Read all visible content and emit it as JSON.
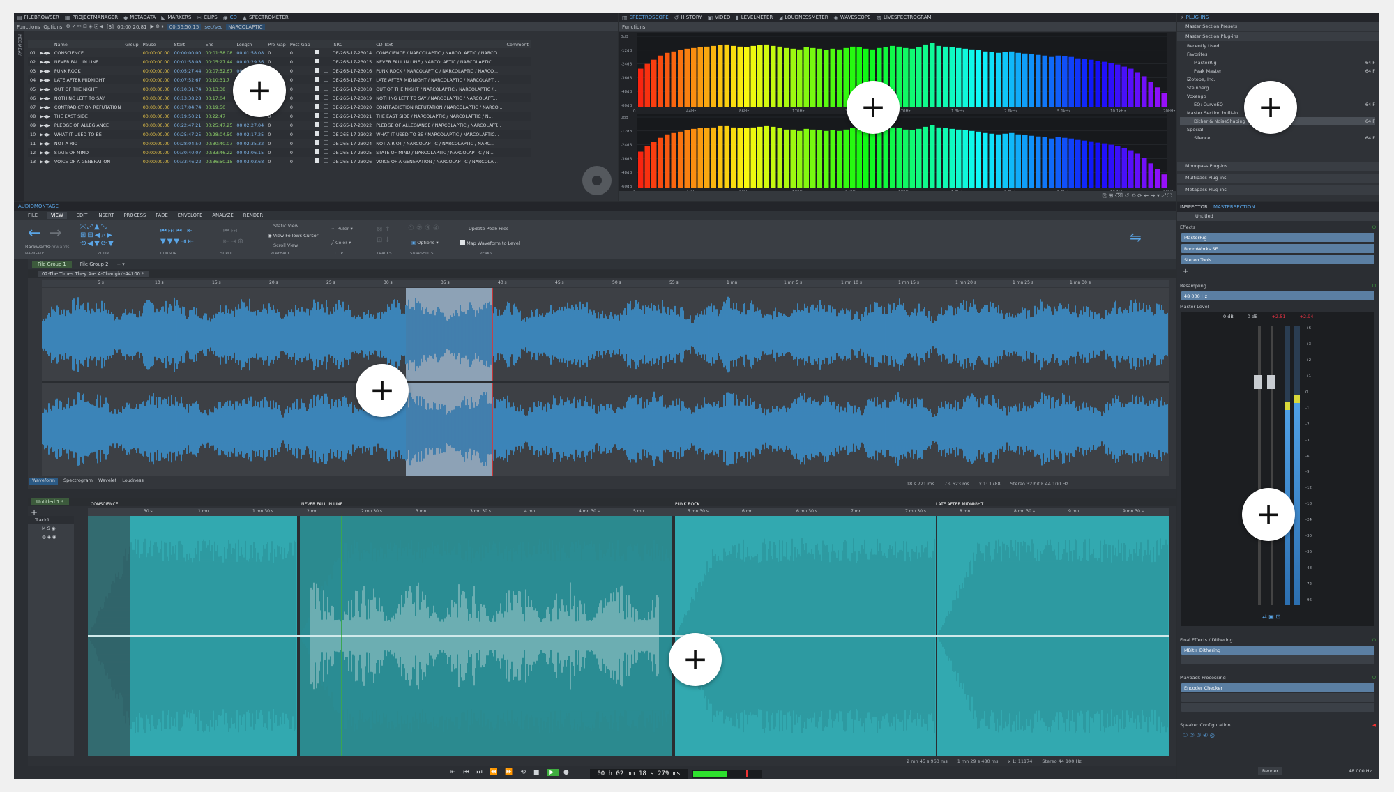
{
  "top_tabs_left": [
    {
      "icon": "file-browser-icon",
      "glyph": "▤",
      "label": "FILEBROWSER"
    },
    {
      "icon": "project-manager-icon",
      "glyph": "▦",
      "label": "PROJECTMANAGER"
    },
    {
      "icon": "metadata-icon",
      "glyph": "◆",
      "label": "METADATA"
    },
    {
      "icon": "markers-icon",
      "glyph": "◣",
      "label": "MARKERS"
    },
    {
      "icon": "clips-icon",
      "glyph": "✂",
      "label": "CLIPS"
    },
    {
      "icon": "cd-icon",
      "glyph": "◉",
      "label": "CD"
    },
    {
      "icon": "spectrometer-icon",
      "glyph": "▲",
      "label": "SPECTROMETER"
    }
  ],
  "top_tabs_mid": [
    {
      "icon": "spectroscope-icon",
      "glyph": "▥",
      "label": "SPECTROSCOPE"
    },
    {
      "icon": "history-icon",
      "glyph": "↺",
      "label": "HISTORY"
    },
    {
      "icon": "video-icon",
      "glyph": "▣",
      "label": "VIDEO"
    },
    {
      "icon": "levelmeter-icon",
      "glyph": "▮",
      "label": "LEVELMETER"
    },
    {
      "icon": "loudnessmeter-icon",
      "glyph": "◢",
      "label": "LOUDNESSMETER"
    },
    {
      "icon": "wavescope-icon",
      "glyph": "◈",
      "label": "WAVESCOPE"
    },
    {
      "icon": "livespectrogram-icon",
      "glyph": "▨",
      "label": "LIVESPECTROGRAM"
    }
  ],
  "plugins_tab": "PLUG-INS",
  "cd_toolbar": {
    "functions": "Functions",
    "options": "Options",
    "counter": "[3]",
    "time1": "00:00:20.81",
    "time2": "00:36:50.15",
    "mode": "sec/sec",
    "album": "NARCOLAPTIC"
  },
  "side_label": "MEDIABAY",
  "cd_columns": [
    "Name",
    "Group",
    "Pause",
    "Start",
    "End",
    "Length",
    "Pre-Gap",
    "Post-Gap",
    "ISRC",
    "CD-Text",
    "Comment"
  ],
  "cd_tracks": [
    {
      "n": "01",
      "name": "CONSCIENCE",
      "pause": "00:00:00.00",
      "start": "00:00:00.00",
      "end": "00:01:58.08",
      "len": "00:01:58.08",
      "pre": "0",
      "post": "0",
      "isrc": "DE-265-17-23014",
      "text": "CONSCIENCE / NARCOLAPTIC / NARCOLAPTIC / NARCO..."
    },
    {
      "n": "02",
      "name": "NEVER FALL IN LINE",
      "pause": "00:00:00.00",
      "start": "00:01:58.08",
      "end": "00:05:27.44",
      "len": "00:03:29.36",
      "pre": "0",
      "post": "0",
      "isrc": "DE-265-17-23015",
      "text": "NEVER FALL IN LINE / NARCOLAPTIC / NARCOLAPTIC..."
    },
    {
      "n": "03",
      "name": "PUNK ROCK",
      "pause": "00:00:00.00",
      "start": "00:05:27.44",
      "end": "00:07:52.67",
      "len": "00:02:25.23",
      "pre": "0",
      "post": "0",
      "isrc": "DE-265-17-23016",
      "text": "PUNK ROCK / NARCOLAPTIC / NARCOLAPTIC / NARCO..."
    },
    {
      "n": "04",
      "name": "LATE AFTER MIDNIGHT",
      "pause": "00:00:00.00",
      "start": "00:07:52.67",
      "end": "00:10:31.7",
      "len": "",
      "pre": "0",
      "post": "0",
      "isrc": "DE-265-17-23017",
      "text": "LATE AFTER MIDNIGHT / NARCOLAPTIC / NARCOLAPTI..."
    },
    {
      "n": "05",
      "name": "OUT OF THE NIGHT",
      "pause": "00:00:00.00",
      "start": "00:10:31.74",
      "end": "00:13:38",
      "len": "",
      "pre": "0",
      "post": "0",
      "isrc": "DE-265-17-23018",
      "text": "OUT OF THE NIGHT / NARCOLAPTIC / NARCOLAPTIC /..."
    },
    {
      "n": "06",
      "name": "NOTHING LEFT TO SAY",
      "pause": "00:00:00.00",
      "start": "00:13:38.28",
      "end": "00:17:04",
      "len": "",
      "pre": "0",
      "post": "0",
      "isrc": "DE-265-17-23019",
      "text": "NOTHING LEFT TO SAY / NARCOLAPTIC / NARCOLAPT..."
    },
    {
      "n": "07",
      "name": "CONTRADICTION REFUTATION",
      "pause": "00:00:00.00",
      "start": "00:17:04.74",
      "end": "00:19:50",
      "len": "",
      "pre": "0",
      "post": "0",
      "isrc": "DE-265-17-23020",
      "text": "CONTRADICTION REFUTATION / NARCOLAPTIC / NARCO..."
    },
    {
      "n": "08",
      "name": "THE EAST SIDE",
      "pause": "00:00:00.00",
      "start": "00:19:50.21",
      "end": "00:22:47",
      "len": "",
      "pre": "0",
      "post": "0",
      "isrc": "DE-265-17-23021",
      "text": "THE EAST SIDE / NARCOLAPTIC / NARCOLAPTIC / N..."
    },
    {
      "n": "09",
      "name": "PLEDGE OF ALLEGIANCE",
      "pause": "00:00:00.00",
      "start": "00:22:47.21",
      "end": "00:25:47.25",
      "len": "00:02:27.04",
      "pre": "0",
      "post": "0",
      "isrc": "DE-265-17-23022",
      "text": "PLEDGE OF ALLEGIANCE / NARCOLAPTIC / NARCOLAPT..."
    },
    {
      "n": "10",
      "name": "WHAT IT USED TO BE",
      "pause": "00:00:00.00",
      "start": "00:25:47.25",
      "end": "00:28:04.50",
      "len": "00:02:17.25",
      "pre": "0",
      "post": "0",
      "isrc": "DE-265-17-23023",
      "text": "WHAT IT USED TO BE / NARCOLAPTIC / NARCOLAPTIC..."
    },
    {
      "n": "11",
      "name": "NOT A RIOT",
      "pause": "00:00:00.00",
      "start": "00:28:04.50",
      "end": "00:30:40.07",
      "len": "00:02:35.32",
      "pre": "0",
      "post": "0",
      "isrc": "DE-265-17-23024",
      "text": "NOT A RIOT / NARCOLAPTIC / NARCOLAPTIC / NARC..."
    },
    {
      "n": "12",
      "name": "STATE OF MIND",
      "pause": "00:00:00.00",
      "start": "00:30:40.07",
      "end": "00:33:46.22",
      "len": "00:03:06.15",
      "pre": "0",
      "post": "0",
      "isrc": "DE-265-17-23025",
      "text": "STATE OF MIND / NARCOLAPTIC / NARCOLAPTIC / N..."
    },
    {
      "n": "13",
      "name": "VOICE OF A GENERATION",
      "pause": "00:00:00.00",
      "start": "00:33:46.22",
      "end": "00:36:50.15",
      "len": "00:03:03.68",
      "pre": "0",
      "post": "0",
      "isrc": "DE-265-17-23026",
      "text": "VOICE OF A GENERATION / NARCOLAPTIC / NARCOLA..."
    }
  ],
  "spectro": {
    "functions": "Functions",
    "db_labels": [
      "0dB",
      "-12dB",
      "-24dB",
      "-36dB",
      "-48dB",
      "-60dB"
    ],
    "freq_labels": [
      "0",
      "44Hz",
      "86Hz",
      "170Hz",
      "340Hz",
      "670Hz",
      "1.3kHz",
      "2.6kHz",
      "5.1kHz",
      "10.1kHz",
      "20kHz"
    ],
    "bars_top": [
      0.55,
      0.62,
      0.68,
      0.74,
      0.78,
      0.8,
      0.82,
      0.84,
      0.85,
      0.86,
      0.87,
      0.88,
      0.89,
      0.9,
      0.88,
      0.87,
      0.86,
      0.88,
      0.89,
      0.9,
      0.88,
      0.87,
      0.85,
      0.84,
      0.83,
      0.86,
      0.85,
      0.84,
      0.82,
      0.84,
      0.83,
      0.85,
      0.87,
      0.86,
      0.84,
      0.83,
      0.85,
      0.86,
      0.88,
      0.87,
      0.85,
      0.84,
      0.86,
      0.9,
      0.92,
      0.88,
      0.87,
      0.86,
      0.85,
      0.84,
      0.83,
      0.82,
      0.8,
      0.79,
      0.78,
      0.79,
      0.8,
      0.78,
      0.77,
      0.76,
      0.75,
      0.74,
      0.72,
      0.74,
      0.73,
      0.72,
      0.7,
      0.69,
      0.68,
      0.66,
      0.65,
      0.63,
      0.61,
      0.58,
      0.55,
      0.5,
      0.44,
      0.36,
      0.28,
      0.2
    ],
    "bars_bottom": [
      0.52,
      0.6,
      0.66,
      0.72,
      0.77,
      0.79,
      0.81,
      0.83,
      0.85,
      0.86,
      0.86,
      0.87,
      0.89,
      0.89,
      0.87,
      0.86,
      0.86,
      0.87,
      0.88,
      0.89,
      0.88,
      0.86,
      0.84,
      0.84,
      0.82,
      0.85,
      0.84,
      0.83,
      0.82,
      0.83,
      0.82,
      0.84,
      0.86,
      0.85,
      0.84,
      0.82,
      0.84,
      0.85,
      0.87,
      0.86,
      0.84,
      0.83,
      0.85,
      0.88,
      0.9,
      0.87,
      0.86,
      0.85,
      0.84,
      0.83,
      0.82,
      0.81,
      0.79,
      0.78,
      0.77,
      0.78,
      0.79,
      0.77,
      0.76,
      0.75,
      0.74,
      0.73,
      0.71,
      0.73,
      0.72,
      0.71,
      0.69,
      0.68,
      0.67,
      0.65,
      0.64,
      0.62,
      0.6,
      0.57,
      0.54,
      0.49,
      0.43,
      0.35,
      0.27,
      0.19
    ]
  },
  "plugins": {
    "header": "PLUG-INS",
    "section1": "Master Section Presets",
    "section2": "Master Section Plug-ins",
    "tree": [
      {
        "indent": 1,
        "label": "Recently Used"
      },
      {
        "indent": 1,
        "label": "Favorites"
      },
      {
        "indent": 2,
        "label": "MasterRig",
        "right": "64 F"
      },
      {
        "indent": 2,
        "label": "Peak Master",
        "right": "64 F"
      },
      {
        "indent": 1,
        "label": "iZotope, Inc."
      },
      {
        "indent": 1,
        "label": "Steinberg"
      },
      {
        "indent": 1,
        "label": "Voxengo"
      },
      {
        "indent": 2,
        "label": "EQ: CurveEQ",
        "right": "64 F"
      },
      {
        "indent": 1,
        "label": "Master Section built-in"
      },
      {
        "indent": 2,
        "label": "Dither & NoiseShaping",
        "right": "64 F"
      },
      {
        "indent": 1,
        "label": "Special"
      },
      {
        "indent": 2,
        "label": "Silence",
        "right": "64 F"
      }
    ],
    "bottom": [
      "Monopass Plug-ins",
      "Multipass Plug-ins",
      "Metapass Plug-ins"
    ]
  },
  "audiomontage": {
    "title": "AUDIOMONTAGE",
    "ribbon_tabs": [
      "FILE",
      "VIEW",
      "EDIT",
      "INSERT",
      "PROCESS",
      "FADE",
      "ENVELOPE",
      "ANALYZE",
      "RENDER"
    ],
    "nav_labels": [
      "Backwards",
      "Forwards"
    ],
    "groups": [
      "NAVIGATE",
      "ZOOM",
      "CURSOR",
      "SCROLL",
      "PLAYBACK",
      "CLIP",
      "TRACKS",
      "SNAPSHOTS",
      "PEAKS"
    ],
    "playback_opts": [
      "Static View",
      "View Follows Cursor",
      "Scroll View"
    ],
    "ruler_label": "Ruler",
    "color_label": "Color",
    "options_label": "Options",
    "update_peak": "Update Peak Files",
    "map_waveform": "Map Waveform to Level",
    "file_groups": [
      "File Group 1",
      "File Group 2"
    ],
    "doc_tab": "02-The Times They Are A-Changin'-44100 *",
    "ruler_ticks": [
      "5 s",
      "10 s",
      "15 s",
      "20 s",
      "25 s",
      "30 s",
      "35 s",
      "40 s",
      "45 s",
      "50 s",
      "55 s",
      "1 mn",
      "1 mn 5 s",
      "1 mn 10 s",
      "1 mn 15 s",
      "1 mn 20 s",
      "1 mn 25 s",
      "1 mn 30 s"
    ],
    "view_tabs": [
      "Waveform",
      "Spectrogram",
      "Wavelet",
      "Loudness"
    ],
    "status1": [
      "18 s 721 ms",
      "7 s 623 ms",
      "x 1: 1788",
      "Stereo 32 bit F 44 100 Hz"
    ],
    "untitled_tab": "Untitled 1 *",
    "track_name": "Track1",
    "clip_labels": [
      "CONSCIENCE",
      "NEVER FALL IN LINE",
      "PUNK ROCK",
      "LATE AFTER MIDNIGHT"
    ],
    "montage_ticks": [
      "30 s",
      "1 mn",
      "1 mn 30 s",
      "2 mn",
      "2 mn 30 s",
      "3 mn",
      "3 mn 30 s",
      "4 mn",
      "4 mn 30 s",
      "5 mn",
      "5 mn 30 s",
      "6 mn",
      "6 mn 30 s",
      "7 mn",
      "7 mn 30 s",
      "8 mn",
      "8 mn 30 s",
      "9 mn",
      "9 mn 30 s"
    ],
    "status2": [
      "2 mn 45 s 963 ms",
      "1 mn 29 s 480 ms",
      "x 1: 11174",
      "Stereo 44 100 Hz"
    ]
  },
  "inspector": {
    "tabs": [
      "INSPECTOR",
      "MASTERSECTION"
    ],
    "preset": "Untitled",
    "effects_label": "Effects",
    "effects": [
      "MasterRig",
      "RoomWorks SE",
      "Stereo Tools"
    ],
    "resampling_label": "Resampling",
    "resample_value": "48 000 Hz",
    "master_level_label": "Master Level",
    "level_readouts": [
      "0 dB",
      "0 dB",
      "+2.51",
      "+2.94"
    ],
    "scale": [
      "+6",
      "+3",
      "+2",
      "+1",
      "0",
      "-1",
      "-2",
      "-3",
      "-6",
      "-9",
      "-12",
      "-18",
      "-24",
      "-30",
      "-36",
      "-48",
      "-72",
      "-96"
    ],
    "final_label": "Final Effects / Dithering",
    "final_plugin": "MBit+ Dithering",
    "playback_label": "Playback Processing",
    "playback_plugin": "Encoder Checker",
    "speaker_label": "Speaker Configuration",
    "render": "Render",
    "rate": "48 000 Hz"
  },
  "transport": {
    "time": "00 h 02 mn 18 s 279 ms"
  },
  "colors": {
    "wave_blue": "#3b95d6",
    "wave_teal": "#32a9b0",
    "accent": "#5aa5e6"
  }
}
